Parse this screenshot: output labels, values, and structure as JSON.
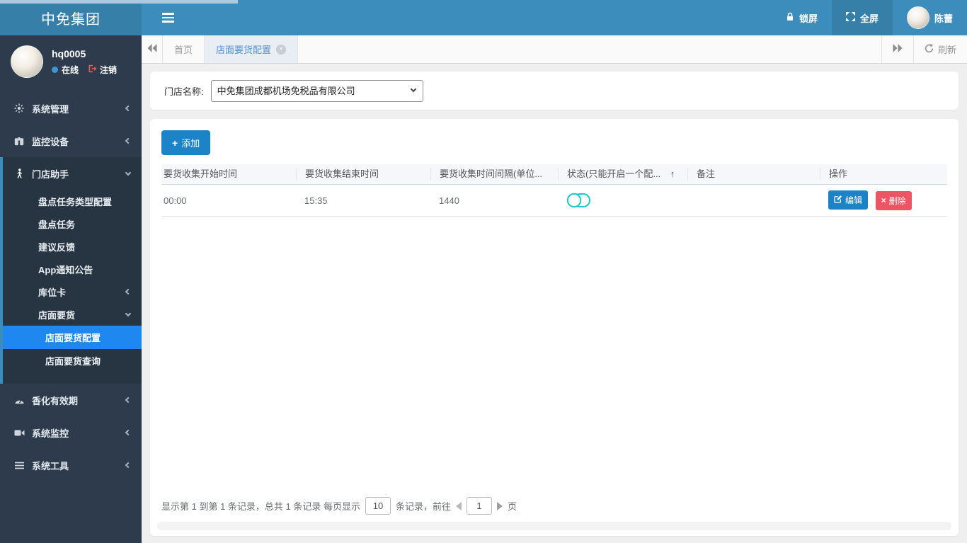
{
  "topbar": {
    "brand": "中免集团",
    "lock_label": "锁屏",
    "fullscreen_label": "全屏",
    "username": "陈蕾"
  },
  "sidebar": {
    "user": {
      "name": "hq0005",
      "status_label": "在线",
      "logout_label": "注销"
    },
    "items": [
      {
        "label": "系统管理",
        "icon": "gear-icon",
        "state": "collapsed"
      },
      {
        "label": "监控设备",
        "icon": "binoculars-icon",
        "state": "collapsed"
      },
      {
        "label": "门店助手",
        "icon": "person-icon",
        "state": "expanded",
        "children": [
          {
            "label": "盘点任务类型配置"
          },
          {
            "label": "盘点任务"
          },
          {
            "label": "建议反馈"
          },
          {
            "label": "App通知公告"
          },
          {
            "label": "库位卡",
            "state": "collapsed"
          },
          {
            "label": "店面要货",
            "state": "expanded",
            "children": [
              {
                "label": "店面要货配置",
                "selected": true
              },
              {
                "label": "店面要货查询",
                "selected": false
              }
            ]
          }
        ]
      },
      {
        "label": "香化有效期",
        "icon": "gauge-icon",
        "state": "collapsed"
      },
      {
        "label": "系统监控",
        "icon": "video-camera-icon",
        "state": "collapsed"
      },
      {
        "label": "系统工具",
        "icon": "bars-icon",
        "state": "collapsed"
      }
    ]
  },
  "tabbar": {
    "tabs": [
      {
        "label": "首页",
        "active": false,
        "closable": false
      },
      {
        "label": "店面要货配置",
        "active": true,
        "closable": true
      }
    ],
    "refresh_label": "刷新"
  },
  "filter": {
    "store_label": "门店名称:",
    "store_value": "中免集团成都机场免税品有限公司"
  },
  "toolbar": {
    "add_label": "添加"
  },
  "table": {
    "headers": [
      "要货收集开始时间",
      "要货收集结束时间",
      "要货收集时间间隔(单位...",
      "状态(只能开启一个配...",
      "备注",
      "操作"
    ],
    "sort_indicator": "↑",
    "rows": [
      {
        "start_time": "00:00",
        "end_time": "15:35",
        "interval": "1440",
        "status": "off",
        "remark": ""
      }
    ],
    "row_actions": {
      "edit_label": "编辑",
      "delete_label": "删除"
    }
  },
  "pagination": {
    "summary_prefix": "显示第 1 到第 1 条记录，总共 1 条记录 每页显示",
    "page_size": "10",
    "summary_middle": "条记录，前往",
    "page_number": "1",
    "summary_suffix": "页"
  },
  "colors": {
    "navbar": "#3c8dbc",
    "navbar_dark": "#367fa9",
    "sidebar": "#2d3b4c",
    "selected_menu_item": "#1e88f0",
    "primary_button": "#1c84c6",
    "danger_button": "#ed5565",
    "toggle": "#23c6c8"
  }
}
